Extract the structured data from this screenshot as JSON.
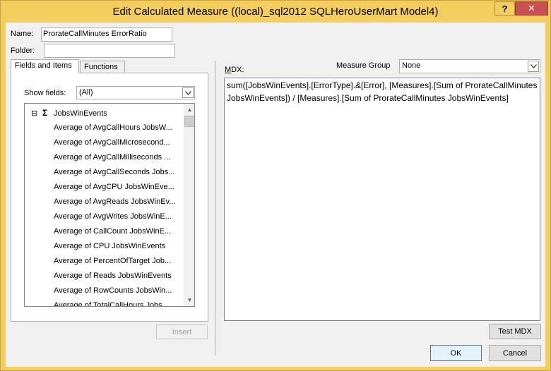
{
  "window": {
    "title": "Edit Calculated Measure ((local)_sql2012 SQLHeroUserMart Model4)",
    "help_label": "?",
    "close_label": "✕"
  },
  "form": {
    "name_label": "Name:",
    "name_value": "ProrateCallMinutes ErrorRatio",
    "folder_label": "Folder:",
    "folder_value": ""
  },
  "tabs": [
    {
      "label": "Fields and Items",
      "active": true
    },
    {
      "label": "Functions",
      "active": false
    }
  ],
  "fields_panel": {
    "show_fields_label": "Show fields:",
    "show_fields_value": "(All)",
    "group_expander": "⊟",
    "group_icon": "Σ",
    "group_name": "JobsWinEvents",
    "items": [
      "Average of AvgCallHours JobsW...",
      "Average of AvgCallMicrosecond...",
      "Average of AvgCallMilliseconds ...",
      "Average of AvgCallSeconds Jobs...",
      "Average of AvgCPU JobsWinEve...",
      "Average of AvgReads JobsWinEv...",
      "Average of AvgWrites JobsWinE...",
      "Average of CallCount JobsWinE...",
      "Average of CPU JobsWinEvents",
      "Average of PercentOfTarget Job...",
      "Average of Reads JobsWinEvents",
      "Average of RowCounts JobsWin...",
      "Average of TotalCallHours Jobs..."
    ],
    "insert_label": "Insert"
  },
  "mdx_panel": {
    "mdx_label": "MDX:",
    "measure_group_label": "Measure Group",
    "measure_group_value": "None",
    "expression": "sum([JobsWinEvents].[ErrorType].&[Error], [Measures].[Sum of ProrateCallMinutes JobsWinEvents]) / [Measures].[Sum of ProrateCallMinutes JobsWinEvents]",
    "test_label": "Test MDX"
  },
  "footer": {
    "ok_label": "OK",
    "cancel_label": "Cancel"
  }
}
